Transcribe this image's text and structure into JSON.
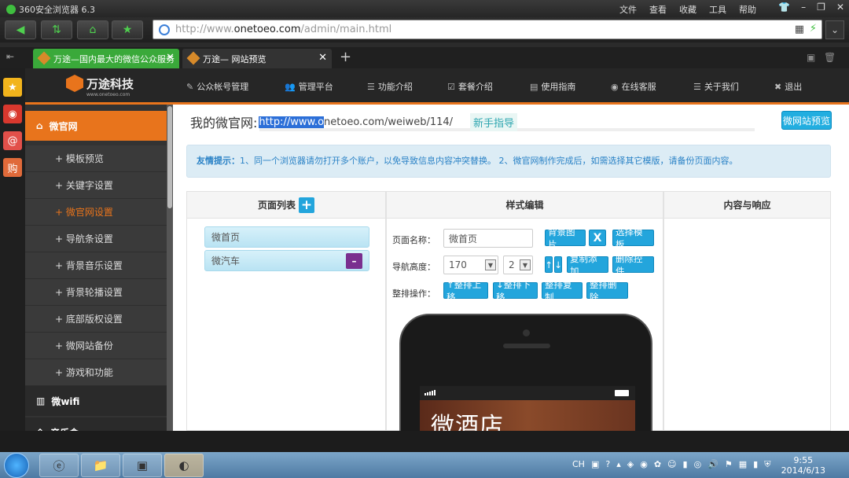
{
  "browser": {
    "title": "360安全浏览器 6.3",
    "menus": [
      "文件",
      "查看",
      "收藏",
      "工具",
      "帮助"
    ],
    "address": {
      "prefix": "http://www.",
      "domain": "onetoeo.com",
      "path": "/admin/main.html"
    },
    "tabs": [
      {
        "label": "万途—国内最大的微信公众服务"
      },
      {
        "label": "万途— 网站预览"
      }
    ],
    "new_tab": "+"
  },
  "app": {
    "logo_text": "万途科技",
    "logo_sub": "www.onetoeo.com",
    "nav": [
      {
        "label": "公众帐号管理",
        "icon": "✎"
      },
      {
        "label": "管理平台",
        "icon": "👥"
      },
      {
        "label": "功能介绍",
        "icon": "☰"
      },
      {
        "label": "套餐介绍",
        "icon": "☑"
      },
      {
        "label": "使用指南",
        "icon": "▤"
      },
      {
        "label": "在线客服",
        "icon": "◉"
      },
      {
        "label": "关于我们",
        "icon": "☰"
      },
      {
        "label": "退出",
        "icon": "✖"
      }
    ],
    "sidebar": {
      "section1": "微官网",
      "items": [
        "模板预览",
        "关键字设置",
        "微官网设置",
        "导航条设置",
        "背景音乐设置",
        "背景轮播设置",
        "底部版权设置",
        "微网站备份",
        "游戏和功能"
      ],
      "active_item": "微官网设置",
      "section2": "微wifi",
      "section3": "音乐盒"
    }
  },
  "content": {
    "mywei_label": "我的微官网:",
    "url_selected": "http://www.o",
    "url_rest": "netoeo.com/weiweb/114/",
    "guide": "新手指导",
    "preview_button": "微网站预览",
    "tip_title": "友情提示：",
    "tip_text": "1、同一个浏览器请勿打开多个账户，以免导致信息内容冲突替换。 2、微官网制作完成后，如需选择其它模版，请备份页面内容。",
    "panel_list_title": "页面列表",
    "panel_style_title": "样式编辑",
    "panel_content_title": "内容与响应",
    "pages": [
      "微首页",
      "微汽车"
    ],
    "page_name_label": "页面名称：",
    "page_name_value": "微首页",
    "bg_image_btn": "背景图片",
    "x_btn": "X",
    "choose_tpl_btn": "选择模板",
    "nav_height_label": "导航高度：",
    "nav_height_value": "170",
    "nav_rows_value": "2",
    "up_btn": "↑",
    "down_btn": "↓",
    "copy_add_btn": "复制添加",
    "delete_ctrl_btn": "删除控件",
    "row_ops_label": "整排操作：",
    "row_up_btn": "↑整排上移",
    "row_down_btn": "↓整排下移",
    "row_copy_btn": "整排复制",
    "row_delete_btn": "整排删除",
    "phone_title": "微酒店"
  },
  "taskbar": {
    "tray_lang": "CH",
    "time": "9:55",
    "date": "2014/6/13"
  }
}
